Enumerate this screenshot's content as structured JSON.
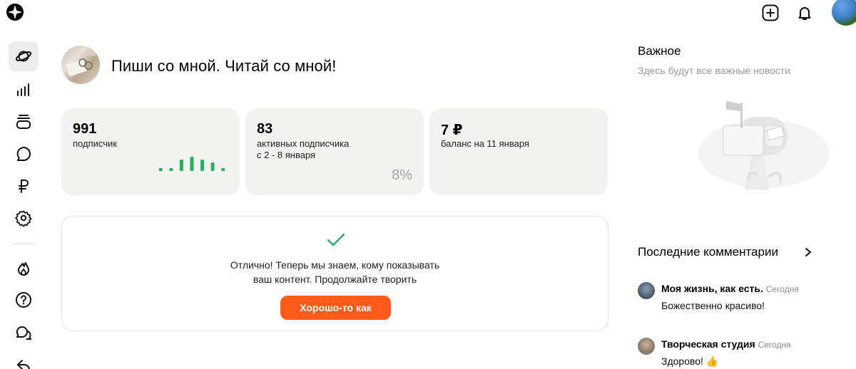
{
  "header": {
    "logo_icon": "compass-star-logo-icon",
    "actions": [
      {
        "name": "create-button",
        "icon": "plus-square-icon"
      },
      {
        "name": "notifications-button",
        "icon": "bell-icon"
      },
      {
        "name": "user-avatar",
        "icon": "avatar"
      }
    ]
  },
  "sidebar": {
    "items": [
      {
        "name": "planet-icon",
        "active": true
      },
      {
        "name": "stats-bars-icon",
        "active": false
      },
      {
        "name": "layers-icon",
        "active": false
      },
      {
        "name": "chat-bubble-icon",
        "active": false
      },
      {
        "name": "ruble-icon",
        "active": false
      },
      {
        "name": "gear-icon",
        "active": false
      },
      {
        "name": "fire-icon",
        "active": false
      },
      {
        "name": "help-icon",
        "active": false
      },
      {
        "name": "chats-icon",
        "active": false
      },
      {
        "name": "back-arrow-icon",
        "active": false
      }
    ]
  },
  "channel": {
    "title": "Пиши со мной. Читай со мной!"
  },
  "stats": [
    {
      "value": "991",
      "label": "подписчик",
      "sparkline": [
        1,
        1,
        4,
        5,
        4,
        3,
        1
      ]
    },
    {
      "value": "83",
      "label": "активных подписчика",
      "label2": "с 2 - 8 января",
      "percent": "8%"
    },
    {
      "value": "7 ₽",
      "label": "баланс на 11 января"
    }
  ],
  "notice": {
    "text_line1": "Отлично! Теперь мы знаем, кому показывать",
    "text_line2": "ваш контент. Продолжайте творить",
    "button": "Хорошо-то как"
  },
  "important": {
    "title": "Важное",
    "subtitle": "Здесь будут все важные новости"
  },
  "comments": {
    "title": "Последние комментарии",
    "items": [
      {
        "author": "Моя жизнь, как есть.",
        "time": "Сегодня",
        "text": "Божественно красиво!"
      },
      {
        "author": "Творческая студия",
        "time": "Сегодня",
        "text": "Здорово! 👍"
      }
    ]
  },
  "colors": {
    "accent": "#ff5a19",
    "success": "#27ae60",
    "card_bg": "#f2f2f1",
    "muted": "#9a9a9a"
  }
}
